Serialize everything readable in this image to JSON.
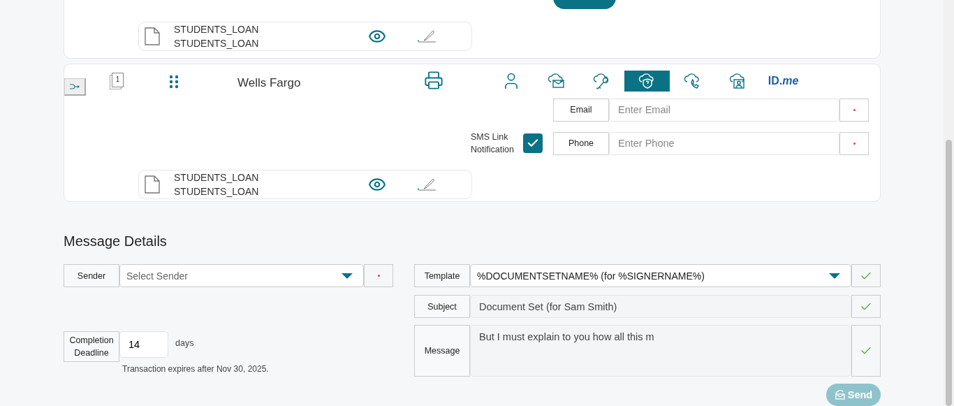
{
  "recipients": [
    {
      "kind": "sign",
      "document": {
        "title": "STUDENTS_LOAN",
        "file": "STUDENTS_LOAN"
      }
    },
    {
      "kind": "signer",
      "name": "Wells Fargo",
      "page_count": "1",
      "auth_methods": [
        {
          "kind": "person",
          "selected": false
        },
        {
          "kind": "cloud-mail",
          "selected": false
        },
        {
          "kind": "cloud-key",
          "selected": false
        },
        {
          "kind": "cloud-shield",
          "selected": true
        },
        {
          "kind": "cloud-phone",
          "selected": false
        },
        {
          "kind": "cloud-person",
          "selected": false
        },
        {
          "kind": "idme",
          "label": "ID.*me*",
          "selected": false
        }
      ],
      "email": {
        "label": "Email",
        "placeholder": "Enter Email"
      },
      "sms": {
        "label": "SMS Link Notification",
        "checked": true
      },
      "phone": {
        "label": "Phone",
        "placeholder": "Enter Phone"
      },
      "document": {
        "title": "STUDENTS_LOAN",
        "file": "STUDENTS_LOAN"
      }
    }
  ],
  "message_details": {
    "title": "Message Details",
    "sender": {
      "label": "Sender",
      "placeholder": "Select Sender"
    },
    "deadline": {
      "label": "Completion Deadline",
      "value": "14",
      "unit": "days",
      "note": "Transaction expires after Nov 30, 2025."
    },
    "template": {
      "label": "Template",
      "value": "%DOCUMENTSETNAME% (for %SIGNERNAME%)"
    },
    "subject": {
      "label": "Subject",
      "value": "Document Set (for Sam Smith)"
    },
    "message": {
      "label": "Message",
      "value": "But I must explain to you how all this m"
    },
    "send": {
      "label": "Send",
      "disabled": true
    }
  }
}
